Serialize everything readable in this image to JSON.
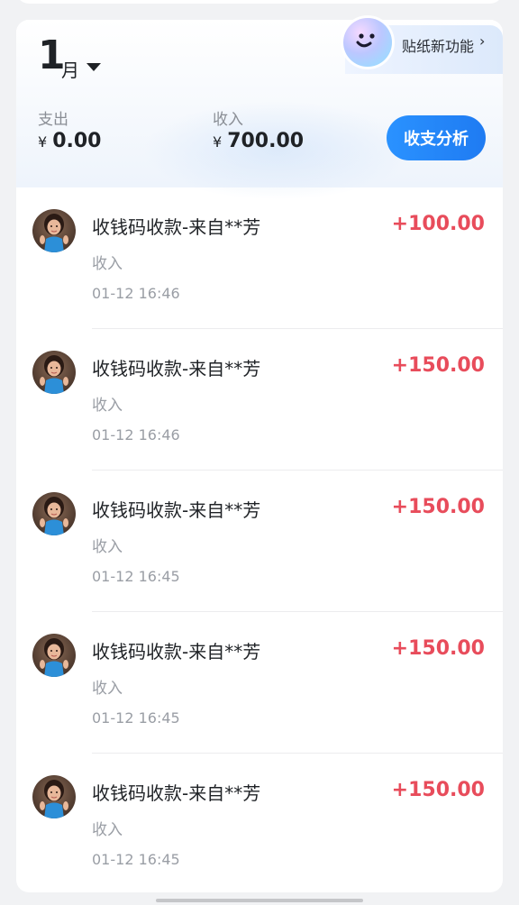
{
  "header": {
    "month_number": "1",
    "month_unit": "月",
    "promo_label": "贴纸新功能",
    "promo_chevron": "›",
    "expense_label": "支出",
    "expense_currency": "¥",
    "expense_value": "0.00",
    "income_label": "收入",
    "income_currency": "¥",
    "income_value": "700.00",
    "analysis_button": "收支分析"
  },
  "transactions": [
    {
      "title": "收钱码收款-来自**芳",
      "type": "收入",
      "time": "01-12 16:46",
      "amount": "+100.00"
    },
    {
      "title": "收钱码收款-来自**芳",
      "type": "收入",
      "time": "01-12 16:46",
      "amount": "+150.00"
    },
    {
      "title": "收钱码收款-来自**芳",
      "type": "收入",
      "time": "01-12 16:45",
      "amount": "+150.00"
    },
    {
      "title": "收钱码收款-来自**芳",
      "type": "收入",
      "time": "01-12 16:45",
      "amount": "+150.00"
    },
    {
      "title": "收钱码收款-来自**芳",
      "type": "收入",
      "time": "01-12 16:45",
      "amount": "+150.00"
    }
  ],
  "colors": {
    "income_amount": "#e84c5b",
    "accent_button": "#1f7bf2"
  },
  "icons": {
    "month_selector": "caret-down-icon",
    "promo": "mascot-sticker-icon",
    "promo_chevron": "chevron-right-icon"
  }
}
